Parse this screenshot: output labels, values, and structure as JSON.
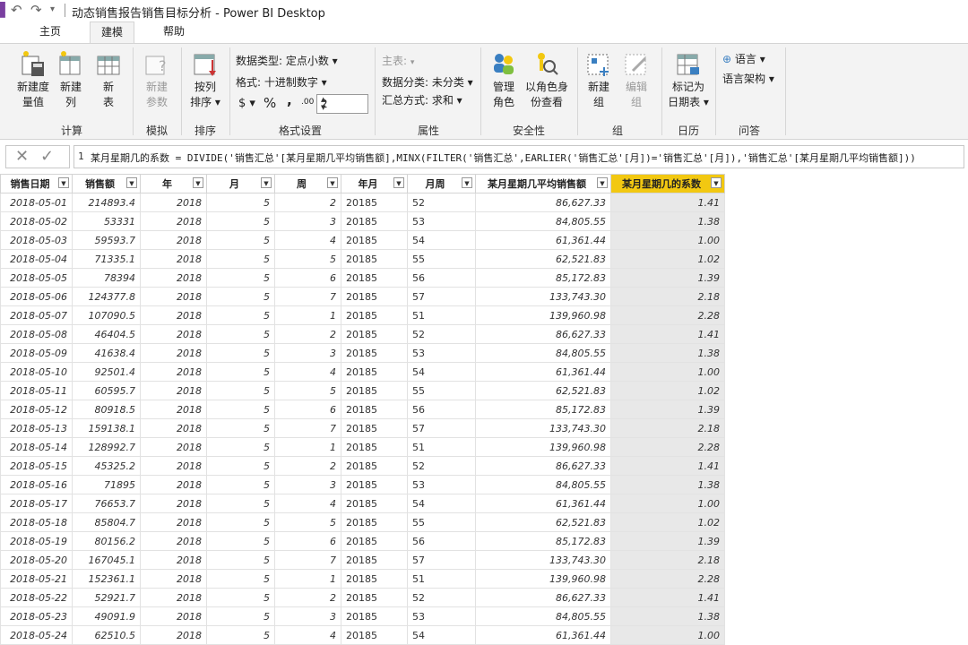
{
  "titlebar": {
    "title": "动态销售报告销售目标分析 - Power BI Desktop"
  },
  "tabs": [
    {
      "label": "主页",
      "active": false
    },
    {
      "label": "建模",
      "active": true
    },
    {
      "label": "帮助",
      "active": false
    }
  ],
  "ribbon": {
    "new_measure": "新建度\n量值",
    "new_column": "新建\n列",
    "new_table": "新\n表",
    "new_param": "新建\n参数",
    "sort_by_col": "按列\n排序 ▾",
    "data_type": "数据类型: 定点小数 ▾",
    "format": "格式: 十进制数字 ▾",
    "currency": "$ ▾",
    "percent": "%",
    "comma": ",",
    "decimal_icon": ".00",
    "decimals": "2",
    "home_table": "主表:",
    "data_category": "数据分类: 未分类 ▾",
    "summarization": "汇总方式: 求和 ▾",
    "manage_roles": "管理\n角色",
    "view_as_roles": "以角色身\n份查看",
    "new_group": "新建\n组",
    "edit_group": "编辑\n组",
    "mark_date_table": "标记为\n日期表 ▾",
    "language": "语言 ▾",
    "linguistic_schema": "语言架构 ▾",
    "groups": {
      "calc": "计算",
      "whatif": "模拟",
      "sort": "排序",
      "formatting": "格式设置",
      "properties": "属性",
      "security": "安全性",
      "groups": "组",
      "calendar": "日历",
      "qa": "问答"
    }
  },
  "formula": {
    "line_no": "1",
    "text": "某月星期几的系数 = DIVIDE('销售汇总'[某月星期几平均销售额],MINX(FILTER('销售汇总',EARLIER('销售汇总'[月])='销售汇总'[月]),'销售汇总'[某月星期几平均销售额]))"
  },
  "table": {
    "columns": [
      "销售日期",
      "销售额",
      "年",
      "月",
      "周",
      "年月",
      "月周",
      "某月星期几平均销售额",
      "某月星期几的系数"
    ],
    "rows": [
      [
        "2018-05-01",
        "214893.4",
        "2018",
        "5",
        "2",
        "20185",
        "52",
        "86,627.33",
        "1.41"
      ],
      [
        "2018-05-02",
        "53331",
        "2018",
        "5",
        "3",
        "20185",
        "53",
        "84,805.55",
        "1.38"
      ],
      [
        "2018-05-03",
        "59593.7",
        "2018",
        "5",
        "4",
        "20185",
        "54",
        "61,361.44",
        "1.00"
      ],
      [
        "2018-05-04",
        "71335.1",
        "2018",
        "5",
        "5",
        "20185",
        "55",
        "62,521.83",
        "1.02"
      ],
      [
        "2018-05-05",
        "78394",
        "2018",
        "5",
        "6",
        "20185",
        "56",
        "85,172.83",
        "1.39"
      ],
      [
        "2018-05-06",
        "124377.8",
        "2018",
        "5",
        "7",
        "20185",
        "57",
        "133,743.30",
        "2.18"
      ],
      [
        "2018-05-07",
        "107090.5",
        "2018",
        "5",
        "1",
        "20185",
        "51",
        "139,960.98",
        "2.28"
      ],
      [
        "2018-05-08",
        "46404.5",
        "2018",
        "5",
        "2",
        "20185",
        "52",
        "86,627.33",
        "1.41"
      ],
      [
        "2018-05-09",
        "41638.4",
        "2018",
        "5",
        "3",
        "20185",
        "53",
        "84,805.55",
        "1.38"
      ],
      [
        "2018-05-10",
        "92501.4",
        "2018",
        "5",
        "4",
        "20185",
        "54",
        "61,361.44",
        "1.00"
      ],
      [
        "2018-05-11",
        "60595.7",
        "2018",
        "5",
        "5",
        "20185",
        "55",
        "62,521.83",
        "1.02"
      ],
      [
        "2018-05-12",
        "80918.5",
        "2018",
        "5",
        "6",
        "20185",
        "56",
        "85,172.83",
        "1.39"
      ],
      [
        "2018-05-13",
        "159138.1",
        "2018",
        "5",
        "7",
        "20185",
        "57",
        "133,743.30",
        "2.18"
      ],
      [
        "2018-05-14",
        "128992.7",
        "2018",
        "5",
        "1",
        "20185",
        "51",
        "139,960.98",
        "2.28"
      ],
      [
        "2018-05-15",
        "45325.2",
        "2018",
        "5",
        "2",
        "20185",
        "52",
        "86,627.33",
        "1.41"
      ],
      [
        "2018-05-16",
        "71895",
        "2018",
        "5",
        "3",
        "20185",
        "53",
        "84,805.55",
        "1.38"
      ],
      [
        "2018-05-17",
        "76653.7",
        "2018",
        "5",
        "4",
        "20185",
        "54",
        "61,361.44",
        "1.00"
      ],
      [
        "2018-05-18",
        "85804.7",
        "2018",
        "5",
        "5",
        "20185",
        "55",
        "62,521.83",
        "1.02"
      ],
      [
        "2018-05-19",
        "80156.2",
        "2018",
        "5",
        "6",
        "20185",
        "56",
        "85,172.83",
        "1.39"
      ],
      [
        "2018-05-20",
        "167045.1",
        "2018",
        "5",
        "7",
        "20185",
        "57",
        "133,743.30",
        "2.18"
      ],
      [
        "2018-05-21",
        "152361.1",
        "2018",
        "5",
        "1",
        "20185",
        "51",
        "139,960.98",
        "2.28"
      ],
      [
        "2018-05-22",
        "52921.7",
        "2018",
        "5",
        "2",
        "20185",
        "52",
        "86,627.33",
        "1.41"
      ],
      [
        "2018-05-23",
        "49091.9",
        "2018",
        "5",
        "3",
        "20185",
        "53",
        "84,805.55",
        "1.38"
      ],
      [
        "2018-05-24",
        "62510.5",
        "2018",
        "5",
        "4",
        "20185",
        "54",
        "61,361.44",
        "1.00"
      ]
    ]
  },
  "colors": {
    "accent": "#f2c811",
    "highlight_col": "#e8e8e8",
    "ribbon_bg": "#f3f3f3"
  }
}
